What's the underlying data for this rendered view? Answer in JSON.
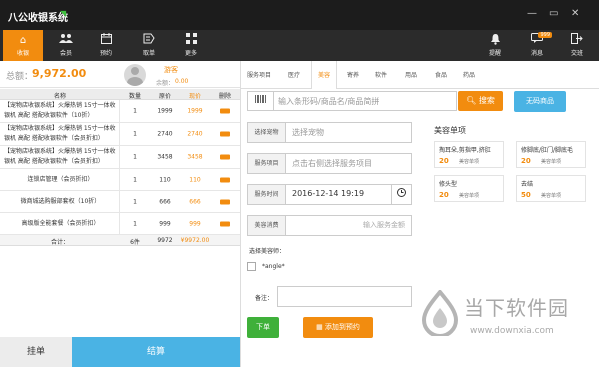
{
  "window": {
    "title": "八公收银系统",
    "minimize": "—",
    "restore": "▭",
    "close": "✕"
  },
  "toolbar": [
    {
      "label": "收银",
      "icon": "home-icon",
      "glyph": "⌂"
    },
    {
      "label": "会员",
      "icon": "members-icon",
      "glyph": "👥"
    },
    {
      "label": "预约",
      "icon": "calendar-icon",
      "glyph": "▦"
    },
    {
      "label": "取单",
      "icon": "take-order-icon",
      "glyph": "☞"
    },
    {
      "label": "更多",
      "icon": "grid-icon",
      "glyph": "▦"
    }
  ],
  "toolbar_right": [
    {
      "label": "提醒",
      "icon": "bell-icon",
      "glyph": "🔔"
    },
    {
      "label": "消息",
      "icon": "message-icon",
      "glyph": "✉",
      "badge": "999"
    },
    {
      "label": "交班",
      "icon": "handover-icon",
      "glyph": "⇥"
    }
  ],
  "summary": {
    "total_label": "总额：",
    "total_value": "9,972.00"
  },
  "member": {
    "name": "游客",
    "points_label": "余额：",
    "points_value": "0.00"
  },
  "order_table": {
    "headers": [
      "名称",
      "数量",
      "原价",
      "现价",
      "删除"
    ],
    "rows": [
      {
        "name": "【宠物店收银系统】火爆热销 15寸一体收银机 高配 搭配收银软件（10折）",
        "qty": "1",
        "orig": "1999",
        "price": "1999"
      },
      {
        "name": "【宠物店收银系统】火爆热销 15寸一体收银机 高配 搭配收银软件（会员折扣）",
        "qty": "1",
        "orig": "2740",
        "price": "2740"
      },
      {
        "name": "【宠物店收银系统】火爆热销 15寸一体收银机 高配 搭配收银软件（会员折扣）",
        "qty": "1",
        "orig": "3458",
        "price": "3458"
      },
      {
        "name": "连锁店管理（会员折扣）",
        "qty": "1",
        "orig": "110",
        "price": "110"
      },
      {
        "name": "微商城选购服部套权（10折）",
        "qty": "1",
        "orig": "666",
        "price": "666"
      },
      {
        "name": "高级版全能套餐（会员折扣）",
        "qty": "1",
        "orig": "999",
        "price": "999"
      }
    ],
    "footer": {
      "label": "合计：",
      "qty": "6件",
      "orig": "9972",
      "price": "¥9972.00"
    }
  },
  "bottom_buttons": {
    "hang": "挂单",
    "settle": "结算"
  },
  "tabs": [
    "服务项目",
    "医疗",
    "美容",
    "寄养",
    "软件",
    "用品",
    "食品",
    "药品"
  ],
  "active_tab": "美容",
  "search": {
    "placeholder": "输入条形码/商品名/商品简拼",
    "button": "搜索",
    "no_code_button": "无码商品",
    "barcode_icon": "barcode-icon"
  },
  "form": {
    "pet_label": "选择宠物",
    "pet_placeholder": "选择宠物",
    "service_label": "服务项目",
    "service_placeholder": "点击右侧选择服务项目",
    "time_label": "服务时间",
    "time_value": "2016-12-14 19:19",
    "fee_label": "美容消费",
    "fee_placeholder": "输入服务金额",
    "groomer_title": "选择美容师：",
    "groomer_option": "*angle*",
    "remark_label": "备注："
  },
  "actions": {
    "order": "下单",
    "appointment": "添加到预约"
  },
  "services": {
    "title": "美容单项",
    "items": [
      {
        "name": "掏耳朵,剪指甲,挤肛",
        "price": "20",
        "category": "美容单项"
      },
      {
        "name": "修脚底/肛门/脚底毛",
        "price": "20",
        "category": "美容单项"
      },
      {
        "name": "修头型",
        "price": "20",
        "category": "美容单项"
      },
      {
        "name": "去结",
        "price": "50",
        "category": "美容单项"
      }
    ]
  },
  "watermark": {
    "text": "当下软件园",
    "url": "www.downxia.com"
  },
  "colors": {
    "accent": "#f28c0f",
    "blue": "#4ab3e4",
    "green": "#3fb03a",
    "dark": "#2b2b2b"
  }
}
